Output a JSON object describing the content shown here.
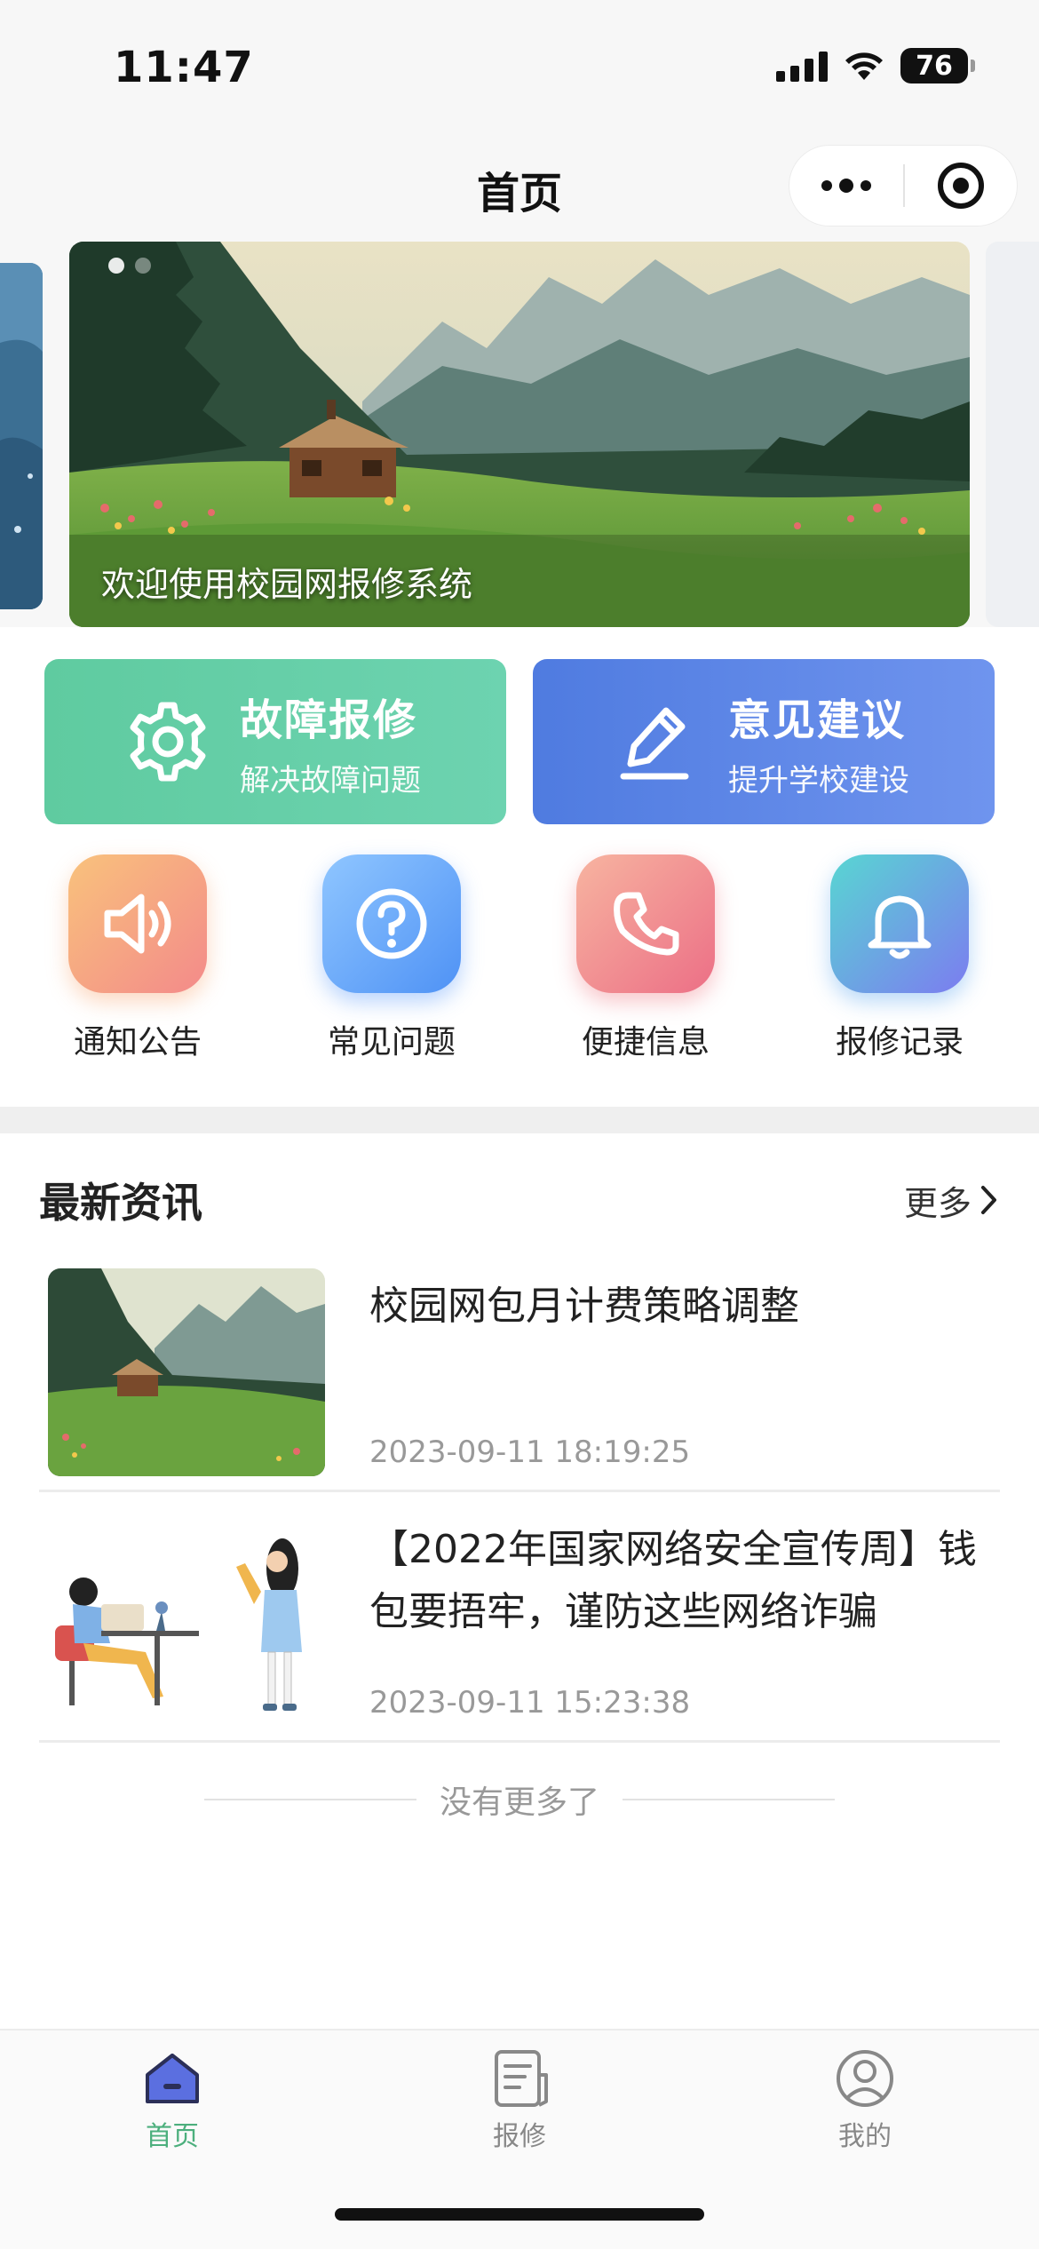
{
  "status_bar": {
    "time": "11:47",
    "battery": "76"
  },
  "nav": {
    "title": "首页"
  },
  "banner": {
    "caption": "欢迎使用校园网报修系统"
  },
  "cards": [
    {
      "title": "故障报修",
      "subtitle": "解决故障问题",
      "icon": "gear-icon",
      "color": "#5fcba0"
    },
    {
      "title": "意见建议",
      "subtitle": "提升学校建设",
      "icon": "pencil-icon",
      "color": "#5a84e6"
    }
  ],
  "grid": [
    {
      "label": "通知公告",
      "icon": "speaker-icon"
    },
    {
      "label": "常见问题",
      "icon": "question-icon"
    },
    {
      "label": "便捷信息",
      "icon": "phone-icon"
    },
    {
      "label": "报修记录",
      "icon": "bell-icon"
    }
  ],
  "news": {
    "title": "最新资讯",
    "more": "更多",
    "items": [
      {
        "title": "校园网包月计费策略调整",
        "date": "2023-09-11 18:19:25"
      },
      {
        "title": "【2022年国家网络安全宣传周】钱包要捂牢，谨防这些网络诈骗",
        "date": "2023-09-11 15:23:38"
      }
    ],
    "no_more": "没有更多了"
  },
  "tabbar": [
    {
      "label": "首页",
      "icon": "home-icon",
      "active": true
    },
    {
      "label": "报修",
      "icon": "document-icon",
      "active": false
    },
    {
      "label": "我的",
      "icon": "user-icon",
      "active": false
    }
  ],
  "colors": {
    "accent_green": "#4caf7d",
    "accent_blue": "#5a84e6"
  }
}
